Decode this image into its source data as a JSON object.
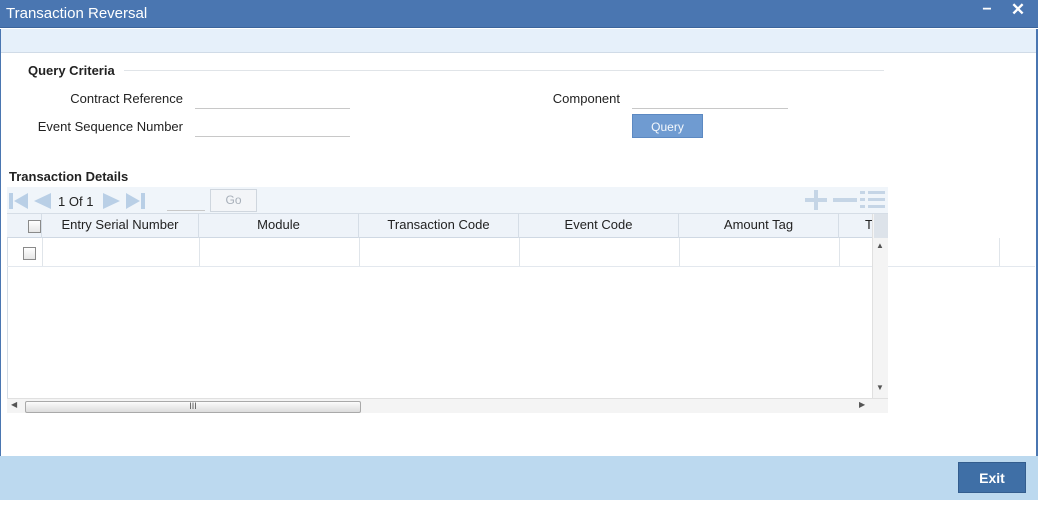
{
  "window": {
    "title": "Transaction Reversal",
    "minimize_glyph": "−",
    "close_glyph": "✕"
  },
  "query_criteria": {
    "section_title": "Query Criteria",
    "contract_reference_label": "Contract Reference",
    "contract_reference_value": "",
    "event_sequence_label": "Event Sequence Number",
    "event_sequence_value": "",
    "component_label": "Component",
    "component_value": "",
    "query_button": "Query"
  },
  "transaction_details": {
    "section_title": "Transaction Details",
    "pager": {
      "current": "1",
      "of_label": "Of",
      "total": "1",
      "page_input": "",
      "go_button": "Go"
    },
    "columns": [
      "Entry Serial Number",
      "Module",
      "Transaction Code",
      "Event Code",
      "Amount Tag",
      "T"
    ],
    "rows": [
      {
        "entry_serial_number": "",
        "module": "",
        "transaction_code": "",
        "event_code": "",
        "amount_tag": ""
      }
    ],
    "hscroll_grip": "III"
  },
  "footer": {
    "exit_button": "Exit"
  },
  "colors": {
    "titlebar": "#4a76b1",
    "footer": "#bcd9ef",
    "query_button": "#6f9bd1",
    "exit_button": "#3f6fa6"
  }
}
